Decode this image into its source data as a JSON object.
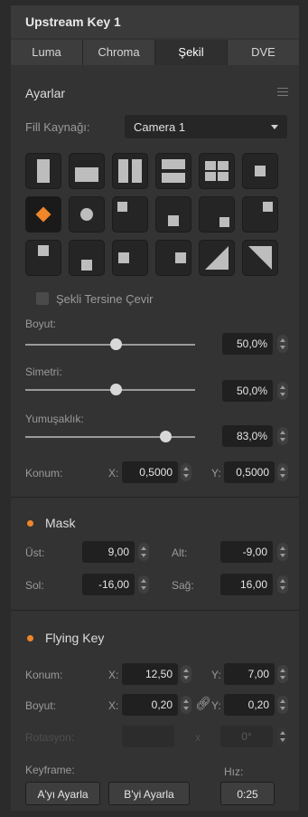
{
  "header": {
    "title": "Upstream Key 1"
  },
  "tabs": [
    {
      "label": "Luma"
    },
    {
      "label": "Chroma"
    },
    {
      "label": "Şekil"
    },
    {
      "label": "DVE"
    }
  ],
  "settings": {
    "title": "Ayarlar",
    "fill_source_label": "Fill Kaynağı:",
    "fill_source_value": "Camera 1",
    "invert_label": "Şekli Tersine Çevir",
    "size_label": "Boyut:",
    "size_value": "50,0%",
    "symmetry_label": "Simetri:",
    "symmetry_value": "50,0%",
    "softness_label": "Yumuşaklık:",
    "softness_value": "83,0%",
    "position_label": "Konum:",
    "pos_x_label": "X:",
    "pos_x_value": "0,5000",
    "pos_y_label": "Y:",
    "pos_y_value": "0,5000"
  },
  "mask": {
    "title": "Mask",
    "top_label": "Üst:",
    "top_value": "9,00",
    "bottom_label": "Alt:",
    "bottom_value": "-9,00",
    "left_label": "Sol:",
    "left_value": "-16,00",
    "right_label": "Sağ:",
    "right_value": "16,00"
  },
  "flying_key": {
    "title": "Flying Key",
    "position_label": "Konum:",
    "x_label": "X:",
    "x_value": "12,50",
    "y_label": "Y:",
    "y_value": "7,00",
    "size_label": "Boyut:",
    "size_x_label": "X:",
    "size_x_value": "0,20",
    "size_y_label": "Y:",
    "size_y_value": "0,20",
    "rotation_label": "Rotasyon:",
    "rotation_x": "x",
    "rotation_value": "0°",
    "keyframe_label": "Keyframe:",
    "set_a": "A'yı Ayarla",
    "set_b": "B'yi Ayarla",
    "speed_label": "Hız:",
    "speed_value": "0:25"
  },
  "colors": {
    "accent": "#f0862a",
    "panel": "#333333"
  }
}
